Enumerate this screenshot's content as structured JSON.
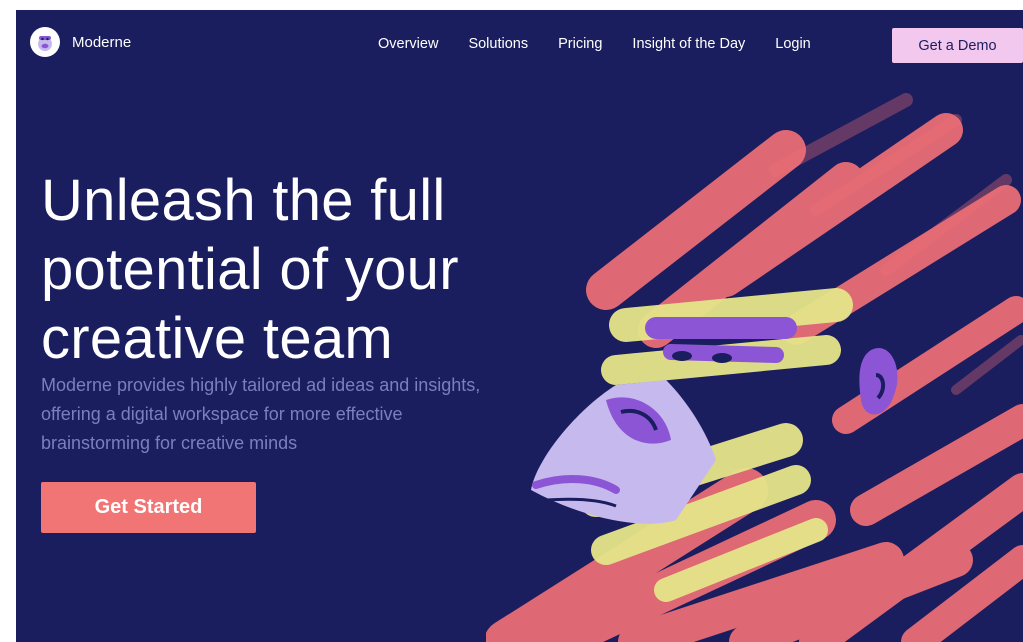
{
  "nav": {
    "brand": "Moderne",
    "links": [
      "Overview",
      "Solutions",
      "Pricing",
      "Insight of the Day",
      "Login"
    ],
    "demo_label": "Get a Demo"
  },
  "hero": {
    "title_line1": "Unleash the full",
    "title_line2": "potential of your",
    "title_line3": "creative team",
    "subtitle": "Moderne provides highly tailored ad ideas and insights, offering a digital workspace for more effective brainstorming for creative minds",
    "cta_label": "Get Started"
  },
  "icons": {
    "logo": "monkey-logo-icon",
    "illustration": "monkey-illustration"
  },
  "colors": {
    "background": "#1a1d5e",
    "accent": "#f07574",
    "demo_button": "#f3c8ee",
    "subtitle": "#7b7fc0",
    "stroke_red": "#ef6f75",
    "stroke_yellow": "#e6e58a",
    "face_lilac": "#c6b9ee",
    "purple": "#8b55d6"
  }
}
